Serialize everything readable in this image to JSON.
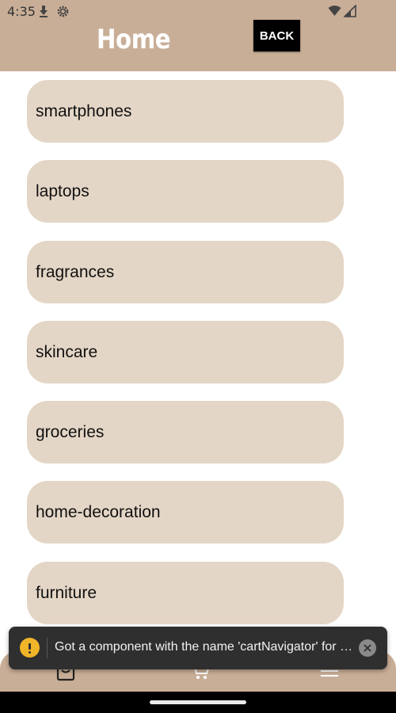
{
  "status_bar": {
    "time": "4:35",
    "icons": [
      "download-icon",
      "gear-icon",
      "wifi-icon",
      "signal-icon"
    ]
  },
  "header": {
    "title": "Home",
    "back_label": "BACK"
  },
  "categories": [
    {
      "label": "smartphones"
    },
    {
      "label": "laptops"
    },
    {
      "label": "fragrances"
    },
    {
      "label": "skincare"
    },
    {
      "label": "groceries"
    },
    {
      "label": "home-decoration"
    },
    {
      "label": "furniture"
    }
  ],
  "tab_bar": {
    "icons": [
      "bag-icon",
      "cart-icon",
      "list-icon"
    ]
  },
  "toast": {
    "message": "Got a component with the name 'cartNavigator' for the screen 'Cart'. React Components must start with an uppercase letter.",
    "icon": "warning-icon"
  },
  "colors": {
    "header_bg": "#c9ae97",
    "item_bg": "#e4d6c6",
    "toast_bg": "#2f2f2f",
    "warning": "#f0b528"
  }
}
